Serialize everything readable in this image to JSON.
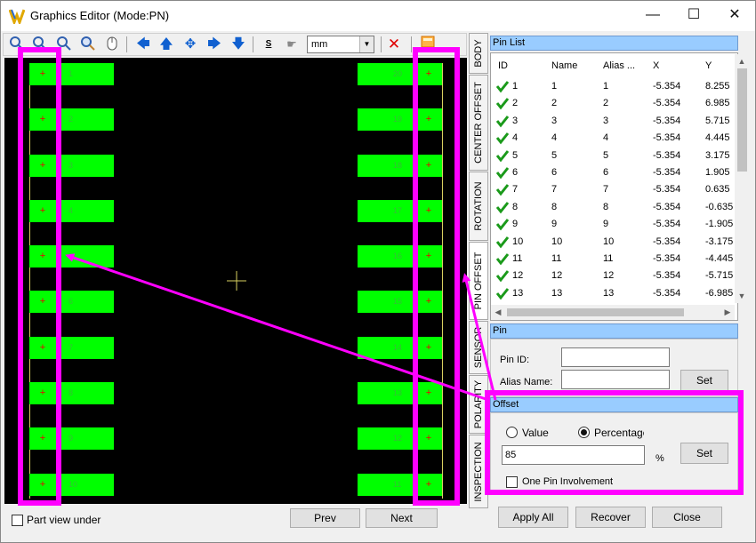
{
  "window": {
    "title": "Graphics Editor (Mode:PN)",
    "minimize_glyph": "—",
    "maximize_glyph": "☐",
    "close_glyph": "✕"
  },
  "toolbar": {
    "unit": "mm",
    "icons": [
      "zoom-in-icon",
      "zoom-out-icon",
      "zoom-fit-icon",
      "zoom-area-icon",
      "mouse-icon",
      "arrow-left-icon",
      "arrow-up-icon",
      "move-center-icon",
      "arrow-right-icon",
      "arrow-down-icon",
      "snap-icon",
      "pan-icon",
      "delete-icon",
      "image-icon"
    ]
  },
  "vertical_tabs": [
    {
      "label": "BODY"
    },
    {
      "label": "CENTER OFFSET"
    },
    {
      "label": "ROTATION"
    },
    {
      "label": "PIN OFFSET"
    },
    {
      "label": "SENSOR"
    },
    {
      "label": "POLARITY"
    },
    {
      "label": "INSPECTION"
    }
  ],
  "pin_list": {
    "title": "Pin List",
    "columns": [
      "ID",
      "Name",
      "Alias ...",
      "X",
      "Y"
    ],
    "rows": [
      {
        "id": "1",
        "name": "1",
        "alias": "1",
        "x": "-5.354",
        "y": "8.255"
      },
      {
        "id": "2",
        "name": "2",
        "alias": "2",
        "x": "-5.354",
        "y": "6.985"
      },
      {
        "id": "3",
        "name": "3",
        "alias": "3",
        "x": "-5.354",
        "y": "5.715"
      },
      {
        "id": "4",
        "name": "4",
        "alias": "4",
        "x": "-5.354",
        "y": "4.445"
      },
      {
        "id": "5",
        "name": "5",
        "alias": "5",
        "x": "-5.354",
        "y": "3.175"
      },
      {
        "id": "6",
        "name": "6",
        "alias": "6",
        "x": "-5.354",
        "y": "1.905"
      },
      {
        "id": "7",
        "name": "7",
        "alias": "7",
        "x": "-5.354",
        "y": "0.635"
      },
      {
        "id": "8",
        "name": "8",
        "alias": "8",
        "x": "-5.354",
        "y": "-0.635"
      },
      {
        "id": "9",
        "name": "9",
        "alias": "9",
        "x": "-5.354",
        "y": "-1.905"
      },
      {
        "id": "10",
        "name": "10",
        "alias": "10",
        "x": "-5.354",
        "y": "-3.175"
      },
      {
        "id": "11",
        "name": "11",
        "alias": "11",
        "x": "-5.354",
        "y": "-4.445"
      },
      {
        "id": "12",
        "name": "12",
        "alias": "12",
        "x": "-5.354",
        "y": "-5.715"
      },
      {
        "id": "13",
        "name": "13",
        "alias": "13",
        "x": "-5.354",
        "y": "-6.985"
      }
    ]
  },
  "pin": {
    "title": "Pin",
    "pin_id_label": "Pin ID:",
    "pin_id_value": "",
    "alias_label": "Alias Name:",
    "alias_value": "",
    "set_label": "Set"
  },
  "offset": {
    "title": "Offset",
    "value_label": "Value",
    "percentage_label": "Percentage",
    "selected": "Percentage",
    "amount": "85",
    "unit": "%",
    "set_label": "Set",
    "one_pin_label": "One Pin Involvement",
    "one_pin_checked": false
  },
  "canvas": {
    "left_pins": [
      "1",
      "2",
      "3",
      "4",
      "5",
      "6",
      "7",
      "8",
      "9",
      "10"
    ],
    "right_pins": [
      "20",
      "19",
      "18",
      "17",
      "16",
      "15",
      "14",
      "13",
      "12",
      "11"
    ]
  },
  "bottom": {
    "part_view_label": "Part view under",
    "prev_label": "Prev",
    "next_label": "Next",
    "apply_all_label": "Apply All",
    "recover_label": "Recover",
    "close_label": "Close"
  },
  "colors": {
    "pad": "#00ff00",
    "annotation": "#ff00ff",
    "header": "#99ccff",
    "check": "#1a9a1a"
  }
}
